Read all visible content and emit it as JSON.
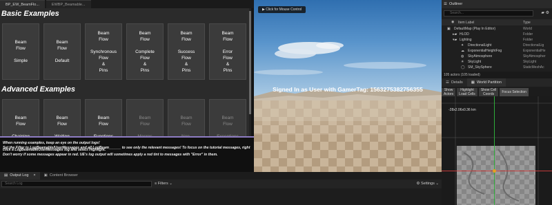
{
  "editor_tabs": [
    {
      "label": "BP_EW_BeamFlo..."
    },
    {
      "label": "EWBP_Beamable..."
    }
  ],
  "widget": {
    "basic_title": "Basic Examples",
    "advanced_title": "Advanced Examples",
    "basic_tiles": [
      {
        "lines": [
          "Beam",
          "Flow",
          "",
          "Simple"
        ]
      },
      {
        "lines": [
          "Beam",
          "Flow",
          "",
          "Default"
        ]
      },
      {
        "lines": [
          "Beam",
          "Flow",
          "",
          "Synchronous",
          "Flow",
          "&",
          "Pins"
        ]
      },
      {
        "lines": [
          "Beam",
          "Flow",
          "",
          "Complete",
          "Flow",
          "&",
          "Pins"
        ]
      },
      {
        "lines": [
          "Beam",
          "Flow",
          "",
          "Success",
          "Flow",
          "&",
          "Pins"
        ]
      },
      {
        "lines": [
          "Beam",
          "Flow",
          "",
          "Error",
          "Flow",
          "&",
          "Pins"
        ]
      }
    ],
    "advanced_tiles": [
      {
        "lines": [
          "Beam",
          "Flow",
          "",
          "Chaining"
        ],
        "dim": false
      },
      {
        "lines": [
          "Beam",
          "Flow",
          "",
          "Waiting"
        ],
        "dim": false
      },
      {
        "lines": [
          "Beam",
          "Flow",
          "",
          "Functions"
        ],
        "dim": false
      },
      {
        "lines": [
          "Beam",
          "Flow",
          "",
          "Macros"
        ],
        "dim": true
      },
      {
        "lines": [
          "Beam",
          "Flow",
          "",
          "Non-",
          "Beam"
        ],
        "dim": true
      },
      {
        "lines": [
          "Beam",
          "Flow",
          "",
          "Exceptions"
        ],
        "dim": true
      }
    ]
  },
  "messages": [
    "When running examples, keep an eye on the output logs!",
    "Set the Filter to LogBeamable/UserMessages and all LogBeam______ to see only the relevant messages! To focus on the tutorial messages, right",
    "click a LogBeamableUserMessages log and select Highlight.",
    "Don't worry if some messages appear in red. UE's log output will sometimes apply a red tint to messages with \"Error\" in them."
  ],
  "viewport": {
    "mouse_button": "Click for Mouse Control",
    "gamertag_text": "Signed In as User with GamerTag: 1563275382756355"
  },
  "output": {
    "tabs": [
      {
        "label": "Output Log",
        "icon": "log-icon"
      },
      {
        "label": "Content Browser",
        "icon": "folder-icon"
      }
    ],
    "search_placeholder": "Search Log",
    "filters_label": "Filters",
    "settings_label": "Settings"
  },
  "outliner": {
    "tab_label": "Outliner",
    "search_placeholder": "Search...",
    "col_label": "Item Label",
    "col_type": "Type",
    "rows": [
      {
        "label": "DefaultMap (Play In Editor)",
        "type": "World"
      },
      {
        "label": "HLOD",
        "type": "Folder"
      },
      {
        "label": "Lighting",
        "type": "Folder"
      },
      {
        "label": "DirectionalLight",
        "type": "DirectionalLig"
      },
      {
        "label": "ExponentialHeightFog",
        "type": "ExponentialHe"
      },
      {
        "label": "SkyAtmosphere",
        "type": "SkyAtmospher"
      },
      {
        "label": "SkyLight",
        "type": "SkyLight"
      },
      {
        "label": "SM_SkySphere",
        "type": "StaticMeshAc"
      }
    ],
    "footer": "105 actors (105 loaded)"
  },
  "world_partition": {
    "tabs": [
      {
        "label": "Details",
        "icon": "details-icon"
      },
      {
        "label": "World Partition",
        "icon": "world-icon"
      }
    ],
    "buttons": [
      {
        "line1": "Show",
        "line2": "Actors"
      },
      {
        "line1": "Highlight",
        "line2": "Load Cells"
      },
      {
        "line1": "Show Cell",
        "line2": "Coords"
      }
    ],
    "focus_label": "Focus Selection",
    "coords_text": "-28x2.06x0.36 km"
  },
  "colors": {
    "accent_purple": "#8e7cc3",
    "tile_bg": "#3b3b3b"
  }
}
